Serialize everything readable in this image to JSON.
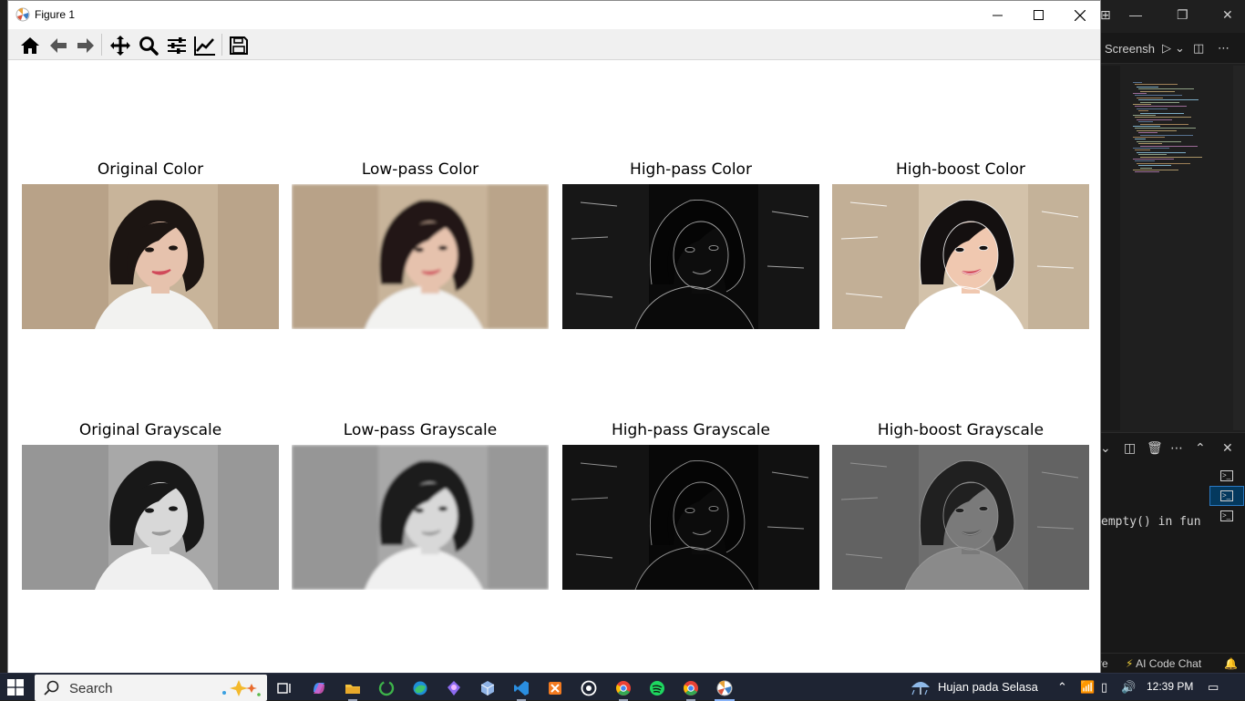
{
  "window": {
    "title": "Figure 1",
    "minimize_icon": "minimize-icon",
    "maximize_icon": "maximize-icon",
    "close_icon": "close-icon"
  },
  "toolbar": {
    "buttons": [
      {
        "name": "home-icon",
        "tooltip": "Home"
      },
      {
        "name": "back-arrow-icon",
        "tooltip": "Back"
      },
      {
        "name": "forward-arrow-icon",
        "tooltip": "Forward"
      },
      {
        "name": "pan-icon",
        "tooltip": "Pan"
      },
      {
        "name": "zoom-icon",
        "tooltip": "Zoom"
      },
      {
        "name": "configure-subplots-icon",
        "tooltip": "Subplots"
      },
      {
        "name": "edit-axis-icon",
        "tooltip": "Customize"
      },
      {
        "name": "save-icon",
        "tooltip": "Save"
      }
    ]
  },
  "figure": {
    "subplots": [
      {
        "title": "Original Color",
        "variant": "original-color"
      },
      {
        "title": "Low-pass Color",
        "variant": "lowpass-color"
      },
      {
        "title": "High-pass Color",
        "variant": "highpass-color"
      },
      {
        "title": "High-boost Color",
        "variant": "highboost-color"
      },
      {
        "title": "Original Grayscale",
        "variant": "original-gray"
      },
      {
        "title": "Low-pass Grayscale",
        "variant": "lowpass-gray"
      },
      {
        "title": "High-pass Grayscale",
        "variant": "highpass-gray"
      },
      {
        "title": "High-boost Grayscale",
        "variant": "highboost-gray"
      }
    ]
  },
  "vscode": {
    "tab_label": "Screensh",
    "terminal_text": "empty() in fun",
    "status_left": "re",
    "status_ai": "AI Code Chat"
  },
  "taskbar": {
    "search_label": "Search",
    "weather_text": "Hujan pada Selasa",
    "clock": "12:39 PM",
    "apps": [
      "task-view-icon",
      "copilot-icon",
      "file-explorer-icon",
      "app-green-circle-icon",
      "edge-icon",
      "app-purple-icon",
      "app-cube-icon",
      "vscode-icon",
      "xampp-icon",
      "whatsapp-icon",
      "chrome-icon",
      "spotify-icon",
      "chrome-alt-icon",
      "python-figure-icon"
    ]
  },
  "colors": {
    "taskbar": "#1e2433",
    "toolbar": "#f0f0f0",
    "vscode_bg": "#1f1f1f"
  }
}
